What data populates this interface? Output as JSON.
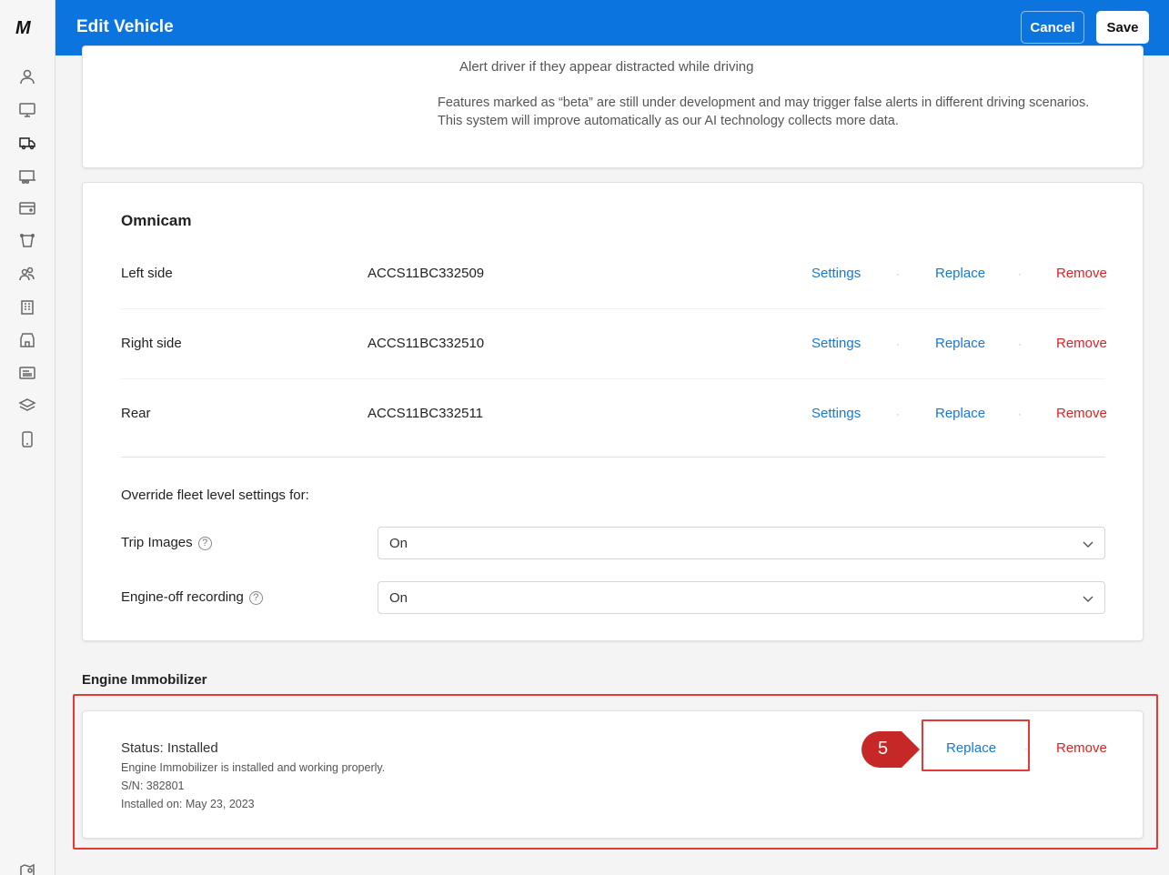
{
  "app": {
    "logo": "M"
  },
  "sidebar": {
    "icons": [
      "user-icon",
      "monitor-icon",
      "truck-icon",
      "trailer-icon",
      "card-icon",
      "asset-icon",
      "people-icon",
      "building-icon",
      "store-icon",
      "news-icon",
      "layers-icon",
      "phone-icon",
      "map-pin-icon"
    ]
  },
  "header": {
    "title": "Edit Vehicle",
    "cancel_label": "Cancel",
    "save_label": "Save"
  },
  "top_card": {
    "alert_text": "Alert driver if they appear distracted while driving",
    "beta_note_line1": "Features marked as “beta” are still under development and may trigger false alerts in different driving scenarios.",
    "beta_note_line2": "This system will improve automatically as our AI technology collects more data."
  },
  "omnicam": {
    "title": "Omnicam",
    "rows": [
      {
        "label": "Left side",
        "serial": "ACCS11BC332509",
        "settings": "Settings",
        "replace": "Replace",
        "remove": "Remove"
      },
      {
        "label": "Right side",
        "serial": "ACCS11BC332510",
        "settings": "Settings",
        "replace": "Replace",
        "remove": "Remove"
      },
      {
        "label": "Rear",
        "serial": "ACCS11BC332511",
        "settings": "Settings",
        "replace": "Replace",
        "remove": "Remove"
      }
    ],
    "separator": "·",
    "override_label": "Override fleet level settings for:",
    "settings": [
      {
        "label": "Trip Images",
        "value": "On"
      },
      {
        "label": "Engine-off recording",
        "value": "On"
      }
    ],
    "help_glyph": "?"
  },
  "engine_immobilizer": {
    "title": "Engine Immobilizer",
    "status": "Status: Installed",
    "description": "Engine Immobilizer is installed and working properly.",
    "serial": "S/N: 382801",
    "installed_on": "Installed on: May 23, 2023",
    "replace": "Replace",
    "separator": "·",
    "remove": "Remove"
  },
  "annotation": {
    "step": "5",
    "color": "#e53935"
  },
  "colors": {
    "header": "#0c74de",
    "link_blue": "#1778d6",
    "link_red": "#e02020"
  }
}
